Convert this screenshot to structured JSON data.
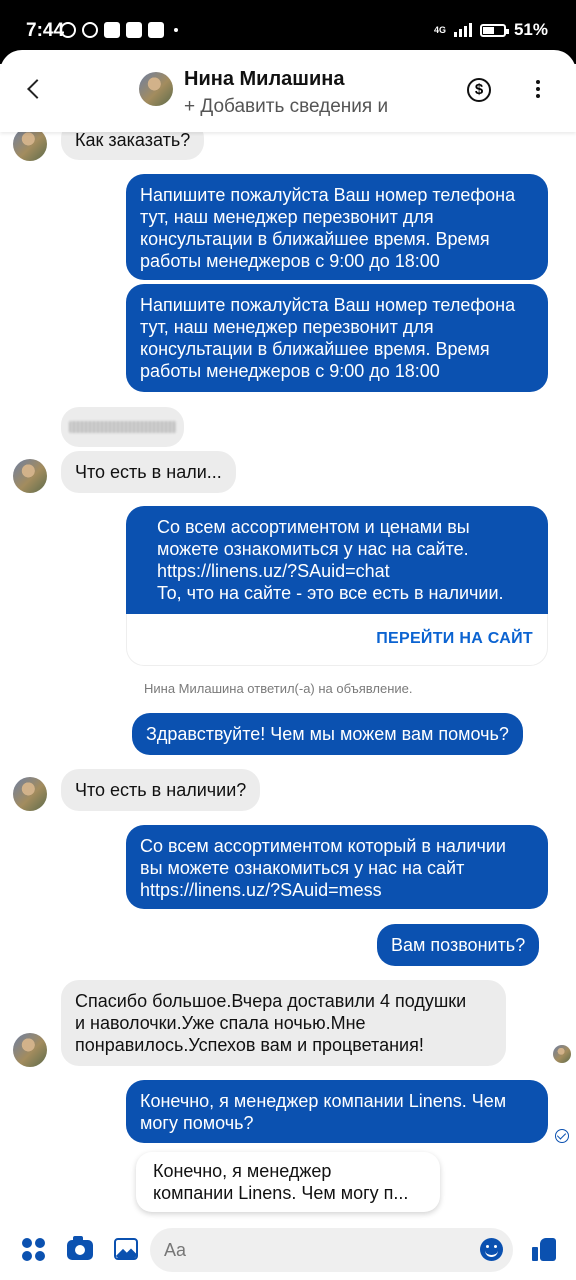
{
  "status_bar": {
    "time": "7:44",
    "network": "4G",
    "battery": "51%"
  },
  "header": {
    "name": "Нина Милашина",
    "subtitle": "+ Добавить сведения и"
  },
  "messages": [
    {
      "side": "in",
      "text": "Как заказать?"
    },
    {
      "side": "out",
      "lines": [
        "Напишите пожалуйста Ваш номер телефона",
        "тут, наш менеджер перезвонит для",
        "консультации в ближайшее время. Время",
        "работы менеджеров с 9:00 до 18:00"
      ]
    },
    {
      "side": "out",
      "lines": [
        "Напишите пожалуйста Ваш номер телефона",
        "тут, наш менеджер перезвонит для",
        "консультации в ближайшее время. Время",
        "работы менеджеров с 9:00 до 18:00"
      ]
    },
    {
      "side": "in",
      "text": "Что есть в нали..."
    },
    {
      "side": "out",
      "lines": [
        "Со всем ассортиментом и ценами вы",
        "можете ознакомиться у нас на сайте.",
        "https://linens.uz/?SAuid=chat",
        "То, что на сайте - это все есть в наличии."
      ],
      "button": "ПЕРЕЙТИ НА САЙТ"
    },
    {
      "side": "out",
      "text": "Здравствуйте! Чем мы можем вам помочь?"
    },
    {
      "side": "in",
      "text": "Что есть в наличии?"
    },
    {
      "side": "out",
      "lines": [
        "Со всем ассортиментом который в наличии",
        "вы можете ознакомиться у нас на сайт",
        "https://linens.uz/?SAuid=mess"
      ]
    },
    {
      "side": "out",
      "text": "Вам позвонить?"
    },
    {
      "side": "in",
      "lines": [
        "Спасибо большое.Вчера доставили 4 подушки",
        "и наволочки.Уже спала ночью.Мне",
        "понравилось.Успехов вам и процветания!"
      ]
    },
    {
      "side": "out",
      "lines": [
        "Конечно, я менеджер компании Linens. Чем",
        "могу помочь?"
      ]
    }
  ],
  "system_note": "Нина Милашина ответил(-а) на объявление.",
  "suggestion": {
    "lines": [
      "Конечно, я менеджер",
      "компании Linens. Чем могу п..."
    ]
  },
  "composer": {
    "placeholder": "Aa"
  },
  "colors": {
    "outgoing": "#0b51b0",
    "incoming": "#ececec",
    "link": "#0b63d1"
  },
  "icons": [
    "back-icon",
    "dollar-icon",
    "more-icon",
    "menu-icon",
    "camera-icon",
    "gallery-icon",
    "emoji-icon",
    "like-icon",
    "sent-check-icon"
  ]
}
